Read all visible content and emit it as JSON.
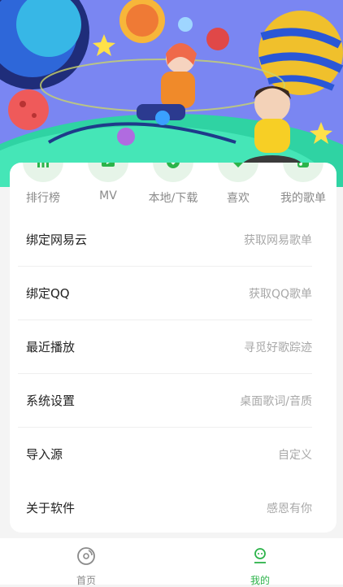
{
  "quick_actions": [
    {
      "label": "排行榜",
      "icon": "chart-icon"
    },
    {
      "label": "MV",
      "icon": "video-icon"
    },
    {
      "label": "本地/下载",
      "icon": "download-icon"
    },
    {
      "label": "喜欢",
      "icon": "heart-icon"
    },
    {
      "label": "我的歌单",
      "icon": "playlist-icon"
    }
  ],
  "menu": [
    {
      "title": "绑定网易云",
      "desc": "获取网易歌单"
    },
    {
      "title": "绑定QQ",
      "desc": "获取QQ歌单"
    },
    {
      "title": "最近播放",
      "desc": "寻觅好歌踪迹"
    },
    {
      "title": "系统设置",
      "desc": "桌面歌词/音质"
    },
    {
      "title": "导入源",
      "desc": "自定义"
    },
    {
      "title": "关于软件",
      "desc": "感恩有你"
    }
  ],
  "bottom_nav": [
    {
      "label": "首页",
      "icon": "music-disc-icon",
      "active": false
    },
    {
      "label": "我的",
      "icon": "profile-icon",
      "active": true
    }
  ],
  "colors": {
    "accent": "#2cb34a",
    "muted": "#8a8a8a",
    "quick_bg": "#e6f4e8"
  }
}
